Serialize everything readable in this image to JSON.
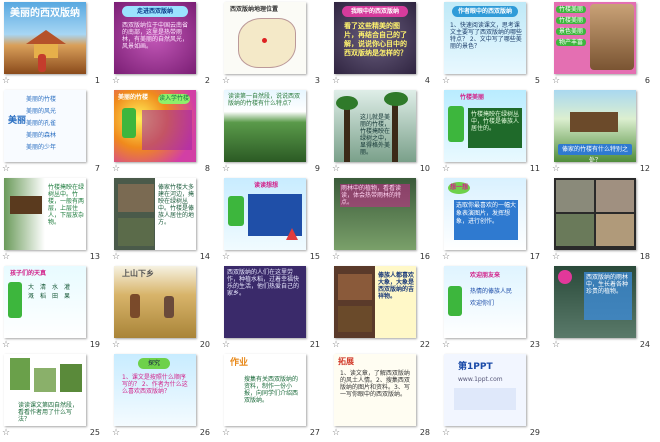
{
  "slides": [
    {
      "num": "1",
      "title": "美丽的西双版纳"
    },
    {
      "num": "2",
      "heading": "走进西双版纳",
      "text": "西双版纳位于中国云南省的南部，这里是热带雨林，有美丽的自然风光，风景如画。"
    },
    {
      "num": "3",
      "heading": "西双版纳地理位置"
    },
    {
      "num": "4",
      "heading": "我眼中的西双版纳",
      "text": "看了这些精美的图片，再结合自己的了解，说说你心目中的西双版纳是怎样的？"
    },
    {
      "num": "5",
      "heading": "作者眼中的西双版纳",
      "text": "1、快速阅读课文，思考课文主要写了西双版纳的哪些特点？ 2、文中写了哪些美丽的景色？"
    },
    {
      "num": "6",
      "labels": [
        "竹楼美丽",
        "竹楼美丽",
        "景色美丽",
        "物产丰富"
      ]
    },
    {
      "num": "7",
      "side": "美丽",
      "items": [
        "美丽的竹楼",
        "美丽的风光",
        "美丽的孔雀",
        "美丽的森林",
        "美丽的少年"
      ]
    },
    {
      "num": "8",
      "heading": "美丽的竹楼",
      "pill": "读入学竹楼"
    },
    {
      "num": "9",
      "text": "读读第一自然段，说说西双版纳的竹楼有什么特点？"
    },
    {
      "num": "10",
      "text": "这儿就是美丽的竹楼，竹楼掩映在绿树之中，显得格外美丽。"
    },
    {
      "num": "11",
      "heading": "竹楼美丽",
      "text": "竹楼掩映在绿树丛中，竹楼是傣族人居住的。"
    },
    {
      "num": "12",
      "caption": "傣家的竹楼有什么特别之处？"
    },
    {
      "num": "13",
      "text": "竹楼掩映在绿树丛中。竹楼，一般有两层，上层住人，下层放杂物。"
    },
    {
      "num": "14",
      "text": "傣家竹楼大多建在河边，掩映在绿树丛中。竹楼是傣族人居住的地方。"
    },
    {
      "num": "15",
      "heading": "读读想想",
      "pill": "读入学"
    },
    {
      "num": "16",
      "text": "雨林中的植物，看看读读，体会热带雨林的特点。"
    },
    {
      "num": "17",
      "box": "选取你最喜欢的一幅大象表演图片，发挥想象，进行创作。",
      "tag": "想一想"
    },
    {
      "num": "18"
    },
    {
      "num": "19",
      "heading": "孩子们的天真",
      "labels": [
        "大",
        "清",
        "水",
        "灌",
        "溉",
        "稻",
        "田",
        "果"
      ]
    },
    {
      "num": "20",
      "title": "上山下乡"
    },
    {
      "num": "21",
      "text": "西双版纳的人们在这里劳作，种植水稻，过着幸福快乐的生活，他们热爱自己的家乡。"
    },
    {
      "num": "22",
      "text": "傣族人都喜欢大象，大象是西双版纳的吉祥物。"
    },
    {
      "num": "23",
      "heading": "欢迎朋友来",
      "items": [
        "热情的傣族人民",
        "欢迎你们"
      ]
    },
    {
      "num": "24",
      "text": "西双版纳的雨林中，生长着各种珍贵的植物。"
    },
    {
      "num": "25",
      "text": "读读课文第四自然段，看看作者用了什么写法？"
    },
    {
      "num": "26",
      "heading": "探究",
      "text": "1、课文是按照什么顺序写的？ 2、作者为什么这么喜欢西双版纳？"
    },
    {
      "num": "27",
      "heading": "作业",
      "text": "搜集有关西双版纳的资料，制作一份小报，向同学们介绍西双版纳。"
    },
    {
      "num": "28",
      "heading": "拓展",
      "text": "1、读文章，了解西双版纳的风土人情。2、搜集西双版纳的图片和资料。3、写一写你眼中的西双版纳。"
    },
    {
      "num": "29",
      "logo_main": "第1PPT",
      "logo_sub": "www.1ppt.com"
    }
  ],
  "colors": {
    "accent": "#2f7a2a",
    "sky": "#7ecbf0",
    "magenta": "#e23ca0",
    "yellow": "#fff59a"
  }
}
